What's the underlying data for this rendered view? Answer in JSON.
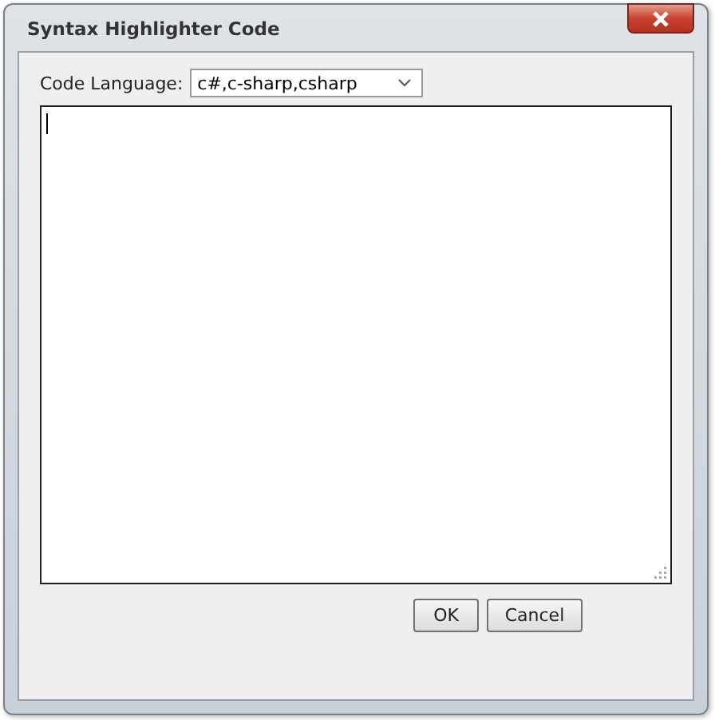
{
  "window": {
    "title": "Syntax Highlighter Code"
  },
  "language": {
    "label": "Code Language:",
    "value": "c#,c-sharp,csharp"
  },
  "buttons": [
    "OK",
    "Cancel"
  ]
}
